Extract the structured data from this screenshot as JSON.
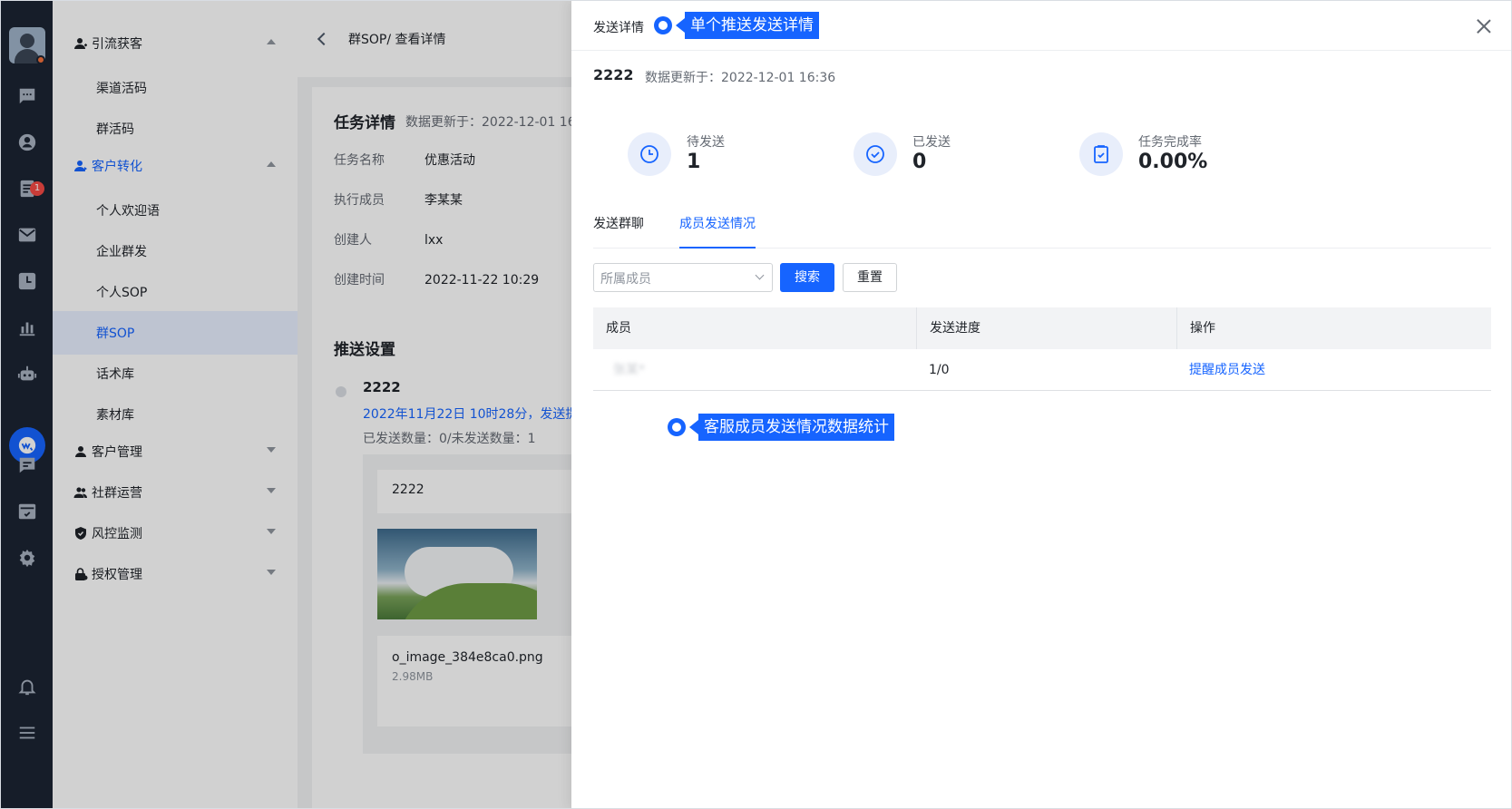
{
  "rail": {
    "badge": "1",
    "icons": [
      "chat-icon",
      "user-circle-icon",
      "document-icon",
      "mail-icon",
      "clock-icon",
      "bar-chart-icon",
      "robot-icon",
      "wechat-icon",
      "message-icon",
      "table-check-icon",
      "settings-icon",
      "bell-icon",
      "menu-icon"
    ]
  },
  "menu": {
    "groups": [
      {
        "label": "引流获客"
      },
      {
        "label": "客户转化"
      },
      {
        "label": "客户管理"
      },
      {
        "label": "社群运营"
      },
      {
        "label": "风控监测"
      },
      {
        "label": "授权管理"
      }
    ],
    "sub_acquire": [
      "渠道活码",
      "群活码"
    ],
    "sub_convert": [
      "个人欢迎语",
      "企业群发",
      "个人SOP",
      "群SOP",
      "话术库",
      "素材库"
    ]
  },
  "page": {
    "breadcrumb": "群SOP/ 查看详情",
    "task_title": "任务详情",
    "task_updated": "数据更新于：2022-12-01 16",
    "rows": [
      {
        "k": "任务名称",
        "v": "优惠活动"
      },
      {
        "k": "执行成员",
        "v": "李某某"
      },
      {
        "k": "创建人",
        "v": "lxx"
      },
      {
        "k": "创建时间",
        "v": "2022-11-22 10:29"
      }
    ],
    "push_title": "推送设置",
    "push_name": "2222",
    "push_time": "2022年11月22日 10时28分，发送提",
    "push_count": "已发送数量：0/未发送数量：1",
    "msg_text": "2222",
    "file_name": "o_image_384e8ca0.png",
    "file_size": "2.98MB"
  },
  "drawer": {
    "title": "发送详情",
    "sop_name": "2222",
    "updated": "数据更新于：2022-12-01 16:36",
    "stats": [
      {
        "label": "待发送",
        "value": "1"
      },
      {
        "label": "已发送",
        "value": "0"
      },
      {
        "label": "任务完成率",
        "value": "0.00%"
      }
    ],
    "tabs": [
      "发送群聊",
      "成员发送情况"
    ],
    "filter": {
      "placeholder": "所属成员",
      "search": "搜索",
      "reset": "重置"
    },
    "table": {
      "headers": [
        "成员",
        "发送进度",
        "操作"
      ],
      "rows": [
        {
          "member": "张某*",
          "progress": "1/0",
          "action": "提醒成员发送"
        }
      ]
    }
  },
  "callouts": {
    "top": "单个推送发送详情",
    "bottom": "客服成员发送情况数据统计"
  },
  "colors": {
    "accent": "#1664ff",
    "rail_bg": "#1c2433",
    "badge": "#f54a45"
  }
}
